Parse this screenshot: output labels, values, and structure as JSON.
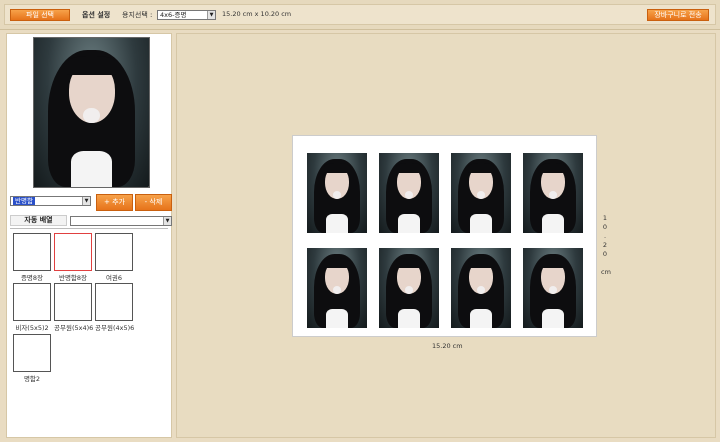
{
  "toolbar": {
    "file_button": "파일 선택",
    "option_label": "옵션 설정",
    "paper_label": "용지선택 :",
    "paper_select": "4x6-증명",
    "paper_size": "15.20 cm x 10.20 cm",
    "send_button": "장바구니로 전송"
  },
  "left": {
    "photo_select": "반명함",
    "add_button": "+ 추가",
    "delete_button": "- 삭제",
    "auto_label": "자동 배열",
    "auto_select": "",
    "layouts": [
      {
        "label": "증명8장"
      },
      {
        "label": "반명함8장"
      },
      {
        "label": "여권6"
      },
      {
        "label": "비자(5x5)2"
      },
      {
        "label": "공무원(5x4)6"
      },
      {
        "label": "공무원(4x5)6"
      },
      {
        "label": "명함2"
      }
    ],
    "selected_layout": "반명함8장"
  },
  "sheet": {
    "width_label": "15.20 cm",
    "height_label": "10.20 cm",
    "photo_count": 8
  },
  "colors": {
    "accent": "#e6731a",
    "background": "#e9dcc2",
    "selected_border": "#e04040"
  }
}
